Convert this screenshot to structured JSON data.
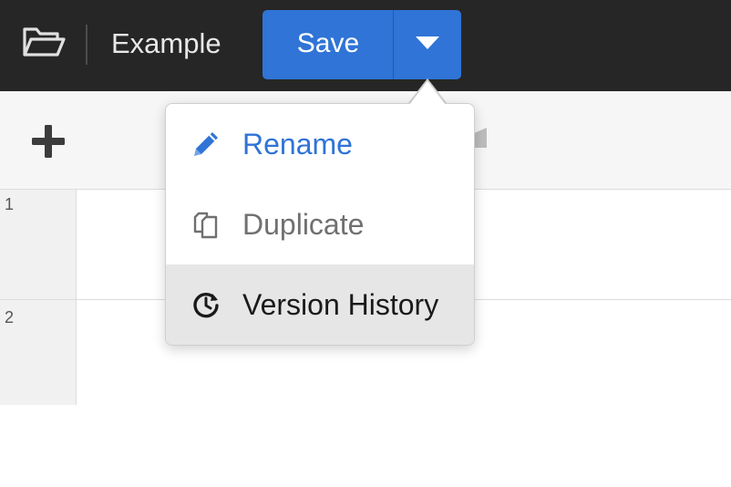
{
  "topbar": {
    "folder_icon": "folder-open-icon",
    "document_title": "Example",
    "save_label": "Save",
    "save_dropdown_icon": "caret-down-icon"
  },
  "toolbar": {
    "add_icon": "plus-icon"
  },
  "grid": {
    "rows": [
      "1",
      "2"
    ]
  },
  "save_menu": {
    "items": [
      {
        "label": "Rename",
        "icon": "pencil-icon"
      },
      {
        "label": "Duplicate",
        "icon": "duplicate-icon"
      },
      {
        "label": "Version History",
        "icon": "history-icon"
      }
    ]
  },
  "colors": {
    "topbar_bg": "#262626",
    "accent": "#2f74d6",
    "menu_hover_bg": "#e6e6e6"
  }
}
